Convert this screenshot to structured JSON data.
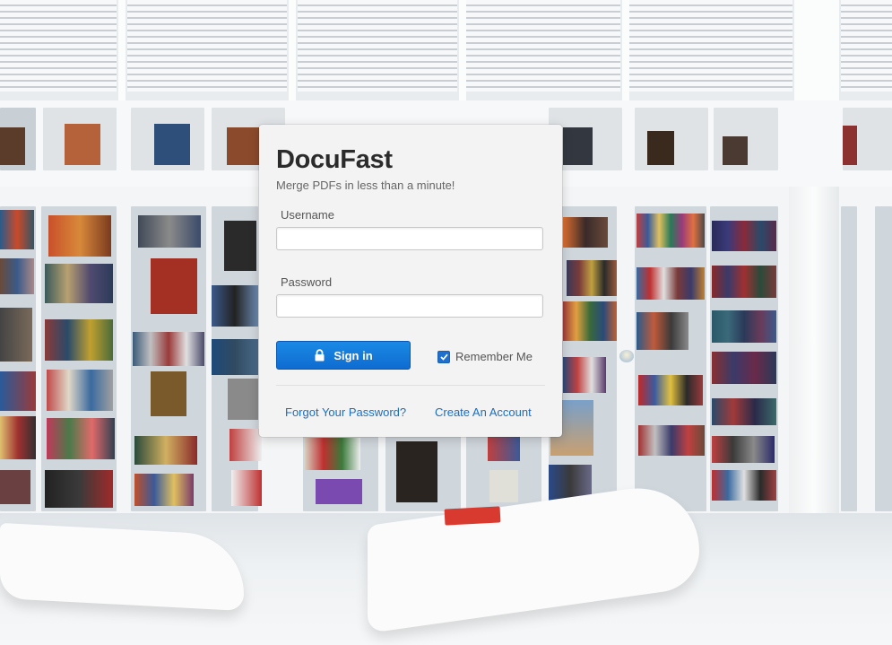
{
  "app": {
    "brand": "DocuFast",
    "tagline": "Merge PDFs in less than a minute!"
  },
  "login": {
    "username_label": "Username",
    "username_value": "",
    "password_label": "Password",
    "password_value": "",
    "signin_label": "Sign in",
    "remember_label": "Remember Me",
    "remember_checked": true,
    "forgot_link": "Forgot Your Password?",
    "create_link": "Create An Account"
  },
  "icons": {
    "signin": "lock-icon",
    "remember": "checkmark-icon"
  },
  "colors": {
    "primary_button": "#0f6bd0",
    "link": "#1a6ec0",
    "brand_text": "#2b2b2b",
    "card_background": "#f3f3f3"
  }
}
